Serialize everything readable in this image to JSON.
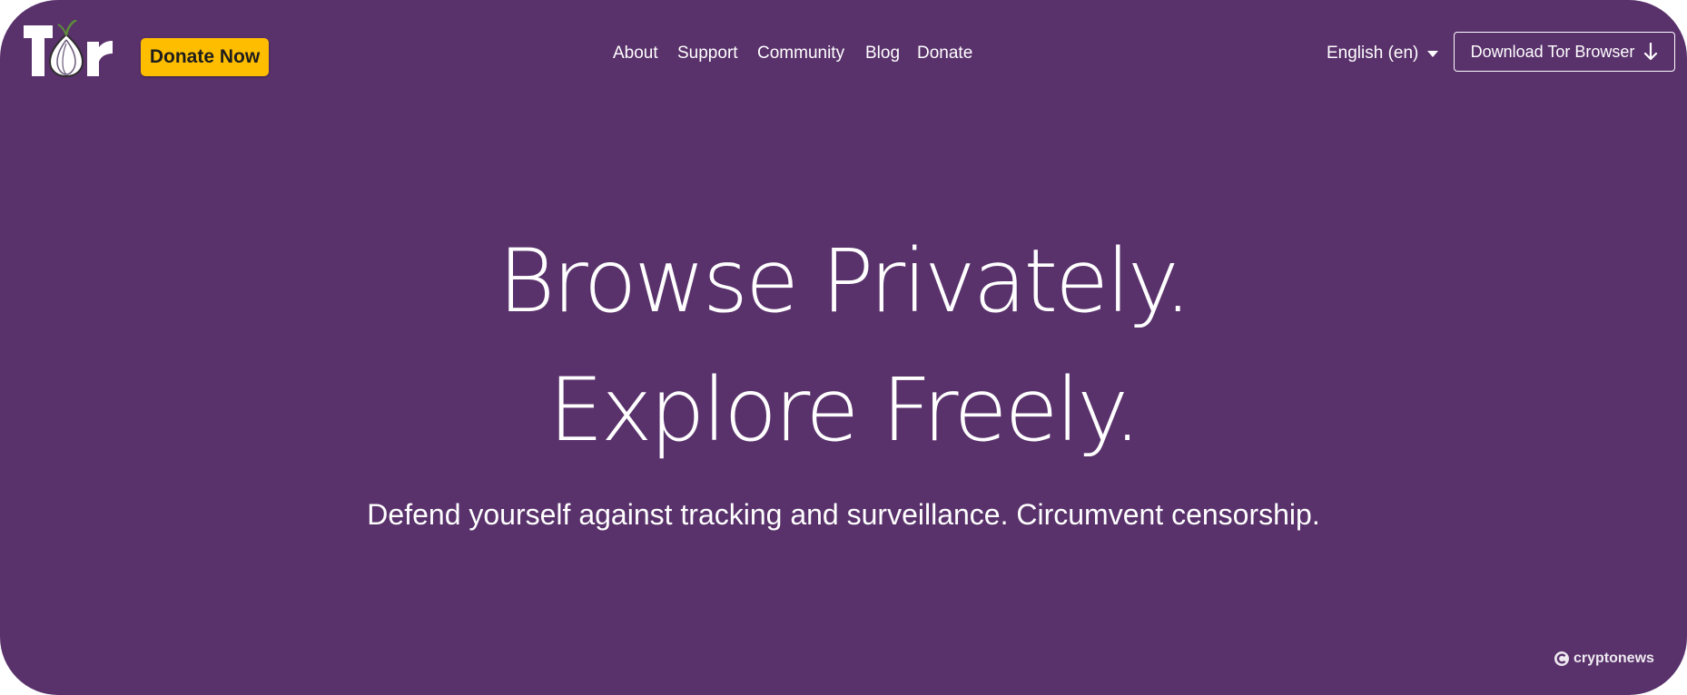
{
  "colors": {
    "background": "#59316b",
    "accent": "#ffbd00",
    "text": "#ffffff"
  },
  "header": {
    "logo_text": "Tor",
    "logo_icon": "tor-onion-logo",
    "donate_button": "Donate Now",
    "nav": [
      "About",
      "Support",
      "Community",
      "Blog",
      "Donate"
    ],
    "language": "English (en)",
    "download_button": "Download Tor Browser",
    "download_icon": "arrow-down-icon"
  },
  "hero": {
    "line1": "Browse Privately.",
    "line2": "Explore Freely.",
    "subtitle": "Defend yourself against tracking and surveillance. Circumvent censorship."
  },
  "watermark": {
    "text": "cryptonews",
    "icon": "cryptonews-logo-icon"
  }
}
